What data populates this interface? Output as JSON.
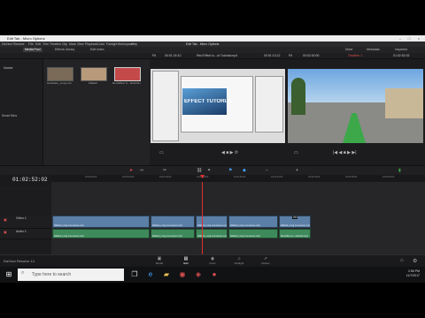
{
  "window": {
    "title": "Edit Tab - Micro Options",
    "center_title": "Edit Tab - Micro Options"
  },
  "menu": [
    "DaVinci Resolve",
    "File",
    "Edit",
    "Trim",
    "Timeline",
    "Clip",
    "Mark",
    "View",
    "Playback",
    "Color",
    "Fairlight",
    "Workspace",
    "Help"
  ],
  "top_tools": {
    "left": [
      "Media Pool",
      "Effects Library",
      "Edit Index"
    ],
    "right": [
      "Mixer",
      "Metadata",
      "Inspector"
    ]
  },
  "viewer_bar": {
    "zoom": "Fit",
    "source_tc": "00:01:24:10",
    "source_name": "Red Effect Iu...ut Tutorial.mp4",
    "source_dur": "00:01:13:12",
    "zoom2": "Fit",
    "record_tc": "00:02:00:00",
    "timeline_name": "Timeline 1",
    "record_dur": "01:02:52:02"
  },
  "sidebar": {
    "items": [
      "Master",
      "Smart Bins"
    ]
  },
  "pool": {
    "header": "Master",
    "clips": [
      {
        "name": "Hardware_Long.mov",
        "color": "#7a6a58"
      },
      {
        "name": "Wallet2",
        "color": "#b69a7a"
      },
      {
        "name": "Red Effect Iu...dtstorial.mp4",
        "color": "#c44a4a"
      }
    ]
  },
  "source_viewer": {
    "logo": "EFFECT TUTORIAL",
    "accent": "#3aa6ff"
  },
  "timeline": {
    "timecode": "01:02:52:02",
    "ruler": [
      "01:00:00:00",
      "01:00:22:00",
      "01:00:44:00",
      "01:01:06:00",
      "01:01:28:00",
      "01:01:50:00",
      "01:02:12:00",
      "01:02:34:00",
      "01:02:56:00",
      "01:03:18:00"
    ],
    "video_track": "Video 1",
    "audio_track": "Audio 1",
    "video_clips": [
      {
        "name": "Wallet2_Long.mov.stereo.mp4"
      },
      {
        "name": "Wallet2_Long.mov.stereo.mp4"
      },
      {
        "name": "Wallet2_Long.mov.stereo.mp4"
      },
      {
        "name": "Wallet2_Long.mov.stereo.mp4"
      },
      {
        "name": "Wallet2_Long.mov.stereo.mp4"
      }
    ],
    "audio_clips": [
      {
        "name": "Wallet2_Long.mov.stereo.mp4"
      },
      {
        "name": "Wallet2_Long.mov.stereo.mp4"
      },
      {
        "name": "Wallet2_Long.mov.stereo.mp4"
      },
      {
        "name": "Wallet2_Long.mov.stereo.mp4"
      },
      {
        "name": "Red Effect Iu...dtstorial.mp4"
      }
    ],
    "flags": [
      "2X0"
    ]
  },
  "pages": [
    {
      "label": "Media",
      "icon": "media-icon",
      "glyph": "▣"
    },
    {
      "label": "Edit",
      "icon": "edit-icon",
      "glyph": "▤",
      "active": true
    },
    {
      "label": "Color",
      "icon": "color-icon",
      "glyph": "◉"
    },
    {
      "label": "Fairlight",
      "icon": "fairlight-icon",
      "glyph": "♫"
    },
    {
      "label": "Deliver",
      "icon": "deliver-icon",
      "glyph": "➚"
    }
  ],
  "project": "DaVinci Resolve 14",
  "taskbar": {
    "search": "Type here to search",
    "time": "2:56 PM",
    "date": "11/7/2017"
  }
}
